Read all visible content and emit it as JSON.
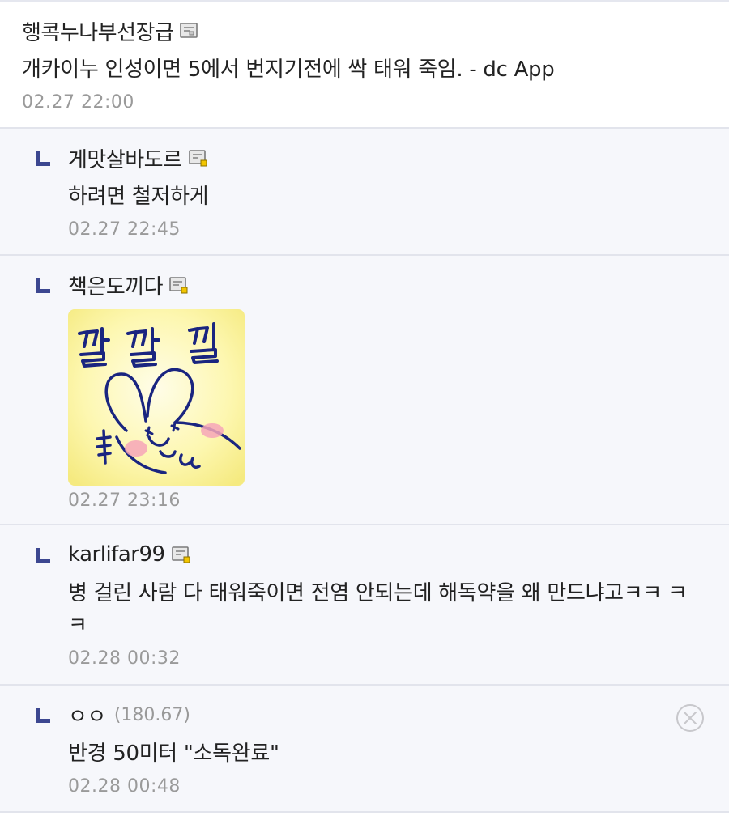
{
  "comments": [
    {
      "nick": "행콕누나부선장급",
      "text": "개카이누 인성이면 5에서 번지기전에 싹 태워 죽임. - dc App",
      "date": "02.27 22:00"
    },
    {
      "nick": "게맛살바도르",
      "text": "하려면 철저하게",
      "date": "02.27 22:45"
    },
    {
      "nick": "책은도끼다",
      "dccon_text": "깔깔낄",
      "date": "02.27 23:16"
    },
    {
      "nick": "karlifar99",
      "text": "병 걸린 사람 다 태워죽이면 전염 안되는데 해독약을 왜 만드냐고ㅋㅋ ㅋㅋ",
      "date": "02.28 00:32"
    },
    {
      "nick": "ㅇㅇ",
      "ip": "(180.67)",
      "text": "반경 50미터 \"소독완료\"",
      "date": "02.28 00:48"
    }
  ],
  "icons": {
    "gallog": "gallog-icon",
    "reply": "reply-arrow-icon",
    "delete": "delete-circle-x-icon"
  },
  "colors": {
    "reply_bg": "#f6f7fb",
    "reply_mark": "#3c4790",
    "date": "#9a9a9a"
  }
}
